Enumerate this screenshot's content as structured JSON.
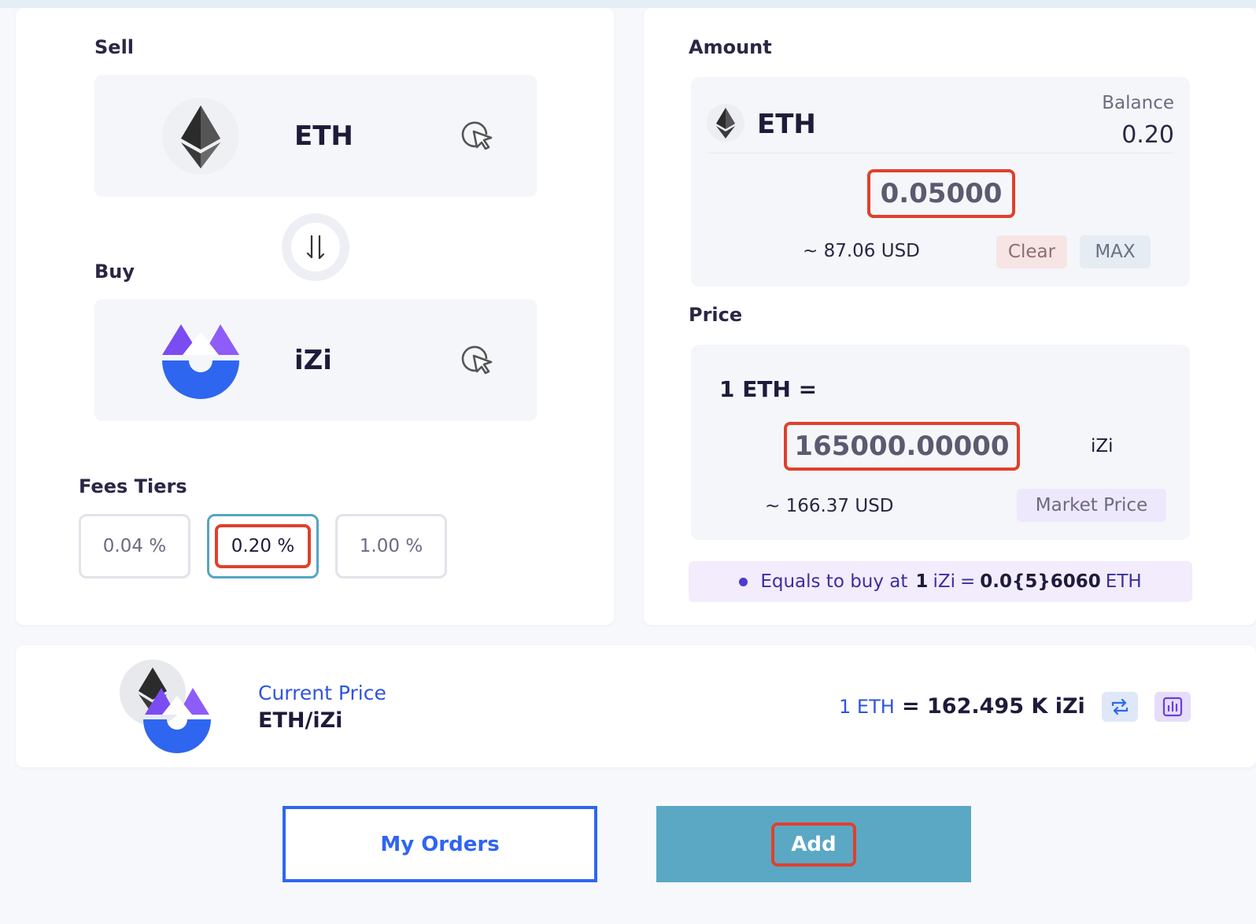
{
  "colors": {
    "accent_teal": "#5aa8c4",
    "brand_blue": "#2f66f0",
    "brand_purple": "#7c4dff",
    "highlight_red": "#e0402c"
  },
  "swap": {
    "sell_label": "Sell",
    "sell_token": "ETH",
    "buy_label": "Buy",
    "buy_token": "iZi",
    "swap_icon": "swap-arrows-icon",
    "select_icon": "pointer-select-icon"
  },
  "fees": {
    "label": "Fees Tiers",
    "tiers": [
      "0.04 %",
      "0.20 %",
      "1.00 %"
    ],
    "selected": "0.20 %"
  },
  "amount": {
    "label": "Amount",
    "token": "ETH",
    "balance_label": "Balance",
    "balance_value": "0.20",
    "input_value": "0.05000",
    "usd": "~ 87.06 USD",
    "clear_label": "Clear",
    "max_label": "MAX"
  },
  "price": {
    "label": "Price",
    "prefix": "1 ETH =",
    "input_value": "165000.00000",
    "unit": "iZi",
    "usd": "~ 166.37 USD",
    "market_label": "Market Price",
    "equals_text": "Equals to buy at",
    "equals_lhs": "1",
    "equals_lhs_token": "iZi",
    "equals_eq": "=",
    "equals_value": "0.0{5}6060",
    "equals_rhs_token": "ETH"
  },
  "current": {
    "label": "Current Price",
    "pair": "ETH/iZi",
    "rate_lhs": "1 ETH",
    "rate_value": "= 162.495 K iZi",
    "swap_icon": "swap-direction-icon",
    "chart_icon": "chart-icon"
  },
  "actions": {
    "my_orders": "My Orders",
    "add": "Add"
  }
}
